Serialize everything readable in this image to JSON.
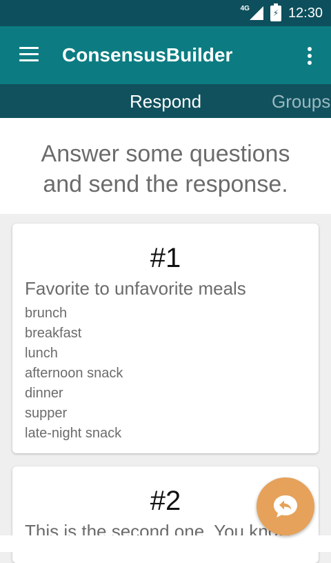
{
  "status_bar": {
    "network": "4G",
    "time": "12:30"
  },
  "app_bar": {
    "title": "ConsensusBuilder",
    "menu_icon": "hamburger-menu-icon",
    "more_icon": "more-vert-icon"
  },
  "tabs": [
    {
      "label": "Respond",
      "selected": true
    },
    {
      "label": "Groups",
      "selected": false
    }
  ],
  "header": {
    "line1": "Answer some questions",
    "line2": "and send the response."
  },
  "cards": [
    {
      "number": "#1",
      "question": "Favorite to unfavorite meals",
      "options": [
        "brunch",
        "breakfast",
        "lunch",
        "afternoon snack",
        "dinner",
        "supper",
        "late-night snack"
      ]
    },
    {
      "number": "#2",
      "question": "This is the second one. You know"
    }
  ],
  "fab": {
    "icon": "reply-icon"
  },
  "colors": {
    "status_bar": "#0d4f5c",
    "app_bar": "#0c7c82",
    "tab_bar": "#10515d",
    "fab": "#e6a25a",
    "text_gray": "#6b6b6b"
  }
}
